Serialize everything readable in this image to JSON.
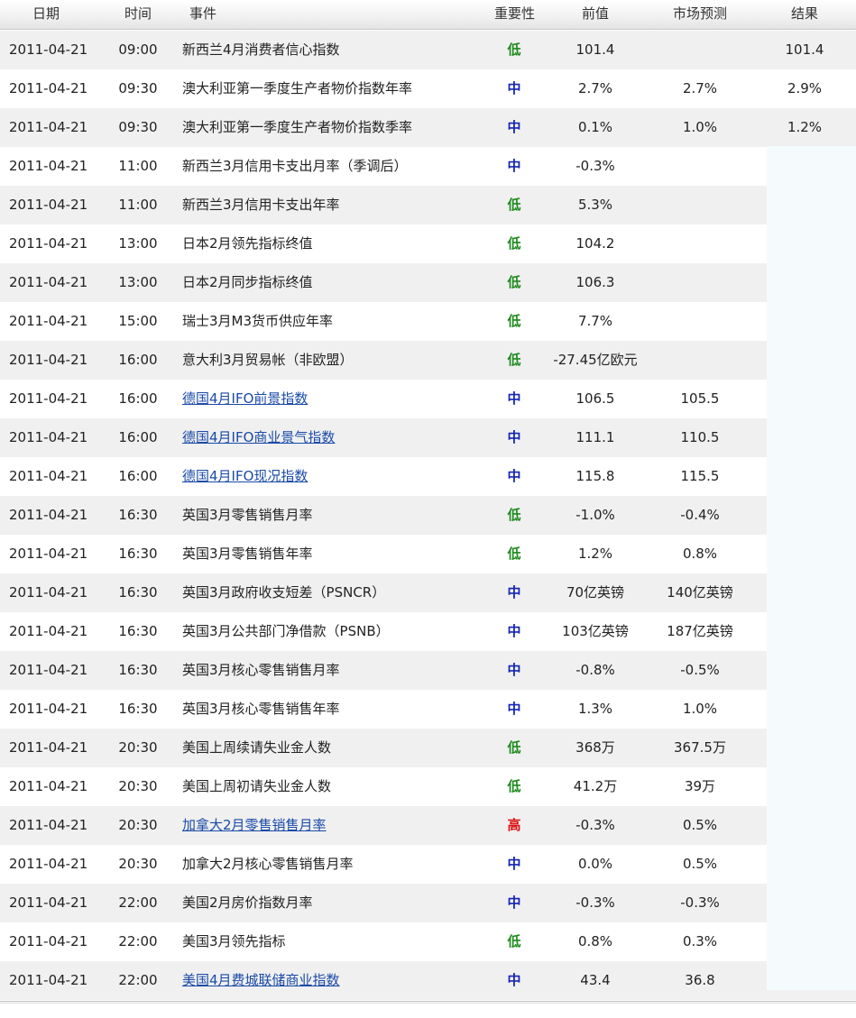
{
  "header": {
    "date": "日期",
    "time": "时间",
    "event": "事件",
    "importance": "重要性",
    "previous": "前值",
    "forecast": "市场预测",
    "result": "结果"
  },
  "importance_colors": {
    "低": "#1d8a1d",
    "中": "#1424b4",
    "高": "#dd1111"
  },
  "rows": [
    {
      "date": "2011-04-21",
      "time": "09:00",
      "event": "新西兰4月消费者信心指数",
      "link": false,
      "importance": "低",
      "previous": "101.4",
      "forecast": "",
      "result": "101.4"
    },
    {
      "date": "2011-04-21",
      "time": "09:30",
      "event": "澳大利亚第一季度生产者物价指数年率",
      "link": false,
      "importance": "中",
      "previous": "2.7%",
      "forecast": "2.7%",
      "result": "2.9%"
    },
    {
      "date": "2011-04-21",
      "time": "09:30",
      "event": "澳大利亚第一季度生产者物价指数季率",
      "link": false,
      "importance": "中",
      "previous": "0.1%",
      "forecast": "1.0%",
      "result": "1.2%"
    },
    {
      "date": "2011-04-21",
      "time": "11:00",
      "event": "新西兰3月信用卡支出月率（季调后）",
      "link": false,
      "importance": "中",
      "previous": "-0.3%",
      "forecast": "",
      "result": ""
    },
    {
      "date": "2011-04-21",
      "time": "11:00",
      "event": "新西兰3月信用卡支出年率",
      "link": false,
      "importance": "低",
      "previous": "5.3%",
      "forecast": "",
      "result": ""
    },
    {
      "date": "2011-04-21",
      "time": "13:00",
      "event": "日本2月领先指标终值",
      "link": false,
      "importance": "低",
      "previous": "104.2",
      "forecast": "",
      "result": ""
    },
    {
      "date": "2011-04-21",
      "time": "13:00",
      "event": "日本2月同步指标终值",
      "link": false,
      "importance": "低",
      "previous": "106.3",
      "forecast": "",
      "result": ""
    },
    {
      "date": "2011-04-21",
      "time": "15:00",
      "event": "瑞士3月M3货币供应年率",
      "link": false,
      "importance": "低",
      "previous": "7.7%",
      "forecast": "",
      "result": ""
    },
    {
      "date": "2011-04-21",
      "time": "16:00",
      "event": "意大利3月贸易帐（非欧盟）",
      "link": false,
      "importance": "低",
      "previous": "-27.45亿欧元",
      "forecast": "",
      "result": ""
    },
    {
      "date": "2011-04-21",
      "time": "16:00",
      "event": "德国4月IFO前景指数",
      "link": true,
      "importance": "中",
      "previous": "106.5",
      "forecast": "105.5",
      "result": ""
    },
    {
      "date": "2011-04-21",
      "time": "16:00",
      "event": "德国4月IFO商业景气指数",
      "link": true,
      "importance": "中",
      "previous": "111.1",
      "forecast": "110.5",
      "result": ""
    },
    {
      "date": "2011-04-21",
      "time": "16:00",
      "event": "德国4月IFO现况指数",
      "link": true,
      "importance": "中",
      "previous": "115.8",
      "forecast": "115.5",
      "result": ""
    },
    {
      "date": "2011-04-21",
      "time": "16:30",
      "event": "英国3月零售销售月率",
      "link": false,
      "importance": "低",
      "previous": "-1.0%",
      "forecast": "-0.4%",
      "result": ""
    },
    {
      "date": "2011-04-21",
      "time": "16:30",
      "event": "英国3月零售销售年率",
      "link": false,
      "importance": "低",
      "previous": "1.2%",
      "forecast": "0.8%",
      "result": ""
    },
    {
      "date": "2011-04-21",
      "time": "16:30",
      "event": "英国3月政府收支短差（PSNCR）",
      "link": false,
      "importance": "中",
      "previous": "70亿英镑",
      "forecast": "140亿英镑",
      "result": ""
    },
    {
      "date": "2011-04-21",
      "time": "16:30",
      "event": "英国3月公共部门净借款（PSNB）",
      "link": false,
      "importance": "中",
      "previous": "103亿英镑",
      "forecast": "187亿英镑",
      "result": ""
    },
    {
      "date": "2011-04-21",
      "time": "16:30",
      "event": "英国3月核心零售销售月率",
      "link": false,
      "importance": "中",
      "previous": "-0.8%",
      "forecast": "-0.5%",
      "result": ""
    },
    {
      "date": "2011-04-21",
      "time": "16:30",
      "event": "英国3月核心零售销售年率",
      "link": false,
      "importance": "中",
      "previous": "1.3%",
      "forecast": "1.0%",
      "result": ""
    },
    {
      "date": "2011-04-21",
      "time": "20:30",
      "event": "美国上周续请失业金人数",
      "link": false,
      "importance": "低",
      "previous": "368万",
      "forecast": "367.5万",
      "result": ""
    },
    {
      "date": "2011-04-21",
      "time": "20:30",
      "event": "美国上周初请失业金人数",
      "link": false,
      "importance": "低",
      "previous": "41.2万",
      "forecast": "39万",
      "result": ""
    },
    {
      "date": "2011-04-21",
      "time": "20:30",
      "event": "加拿大2月零售销售月率",
      "link": true,
      "importance": "高",
      "previous": "-0.3%",
      "forecast": "0.5%",
      "result": ""
    },
    {
      "date": "2011-04-21",
      "time": "20:30",
      "event": "加拿大2月核心零售销售月率",
      "link": false,
      "importance": "中",
      "previous": "0.0%",
      "forecast": "0.5%",
      "result": ""
    },
    {
      "date": "2011-04-21",
      "time": "22:00",
      "event": "美国2月房价指数月率",
      "link": false,
      "importance": "中",
      "previous": "-0.3%",
      "forecast": "-0.3%",
      "result": ""
    },
    {
      "date": "2011-04-21",
      "time": "22:00",
      "event": "美国3月领先指标",
      "link": false,
      "importance": "低",
      "previous": "0.8%",
      "forecast": "0.3%",
      "result": ""
    },
    {
      "date": "2011-04-21",
      "time": "22:00",
      "event": "美国4月费城联储商业指数",
      "link": true,
      "importance": "中",
      "previous": "43.4",
      "forecast": "36.8",
      "result": ""
    }
  ]
}
